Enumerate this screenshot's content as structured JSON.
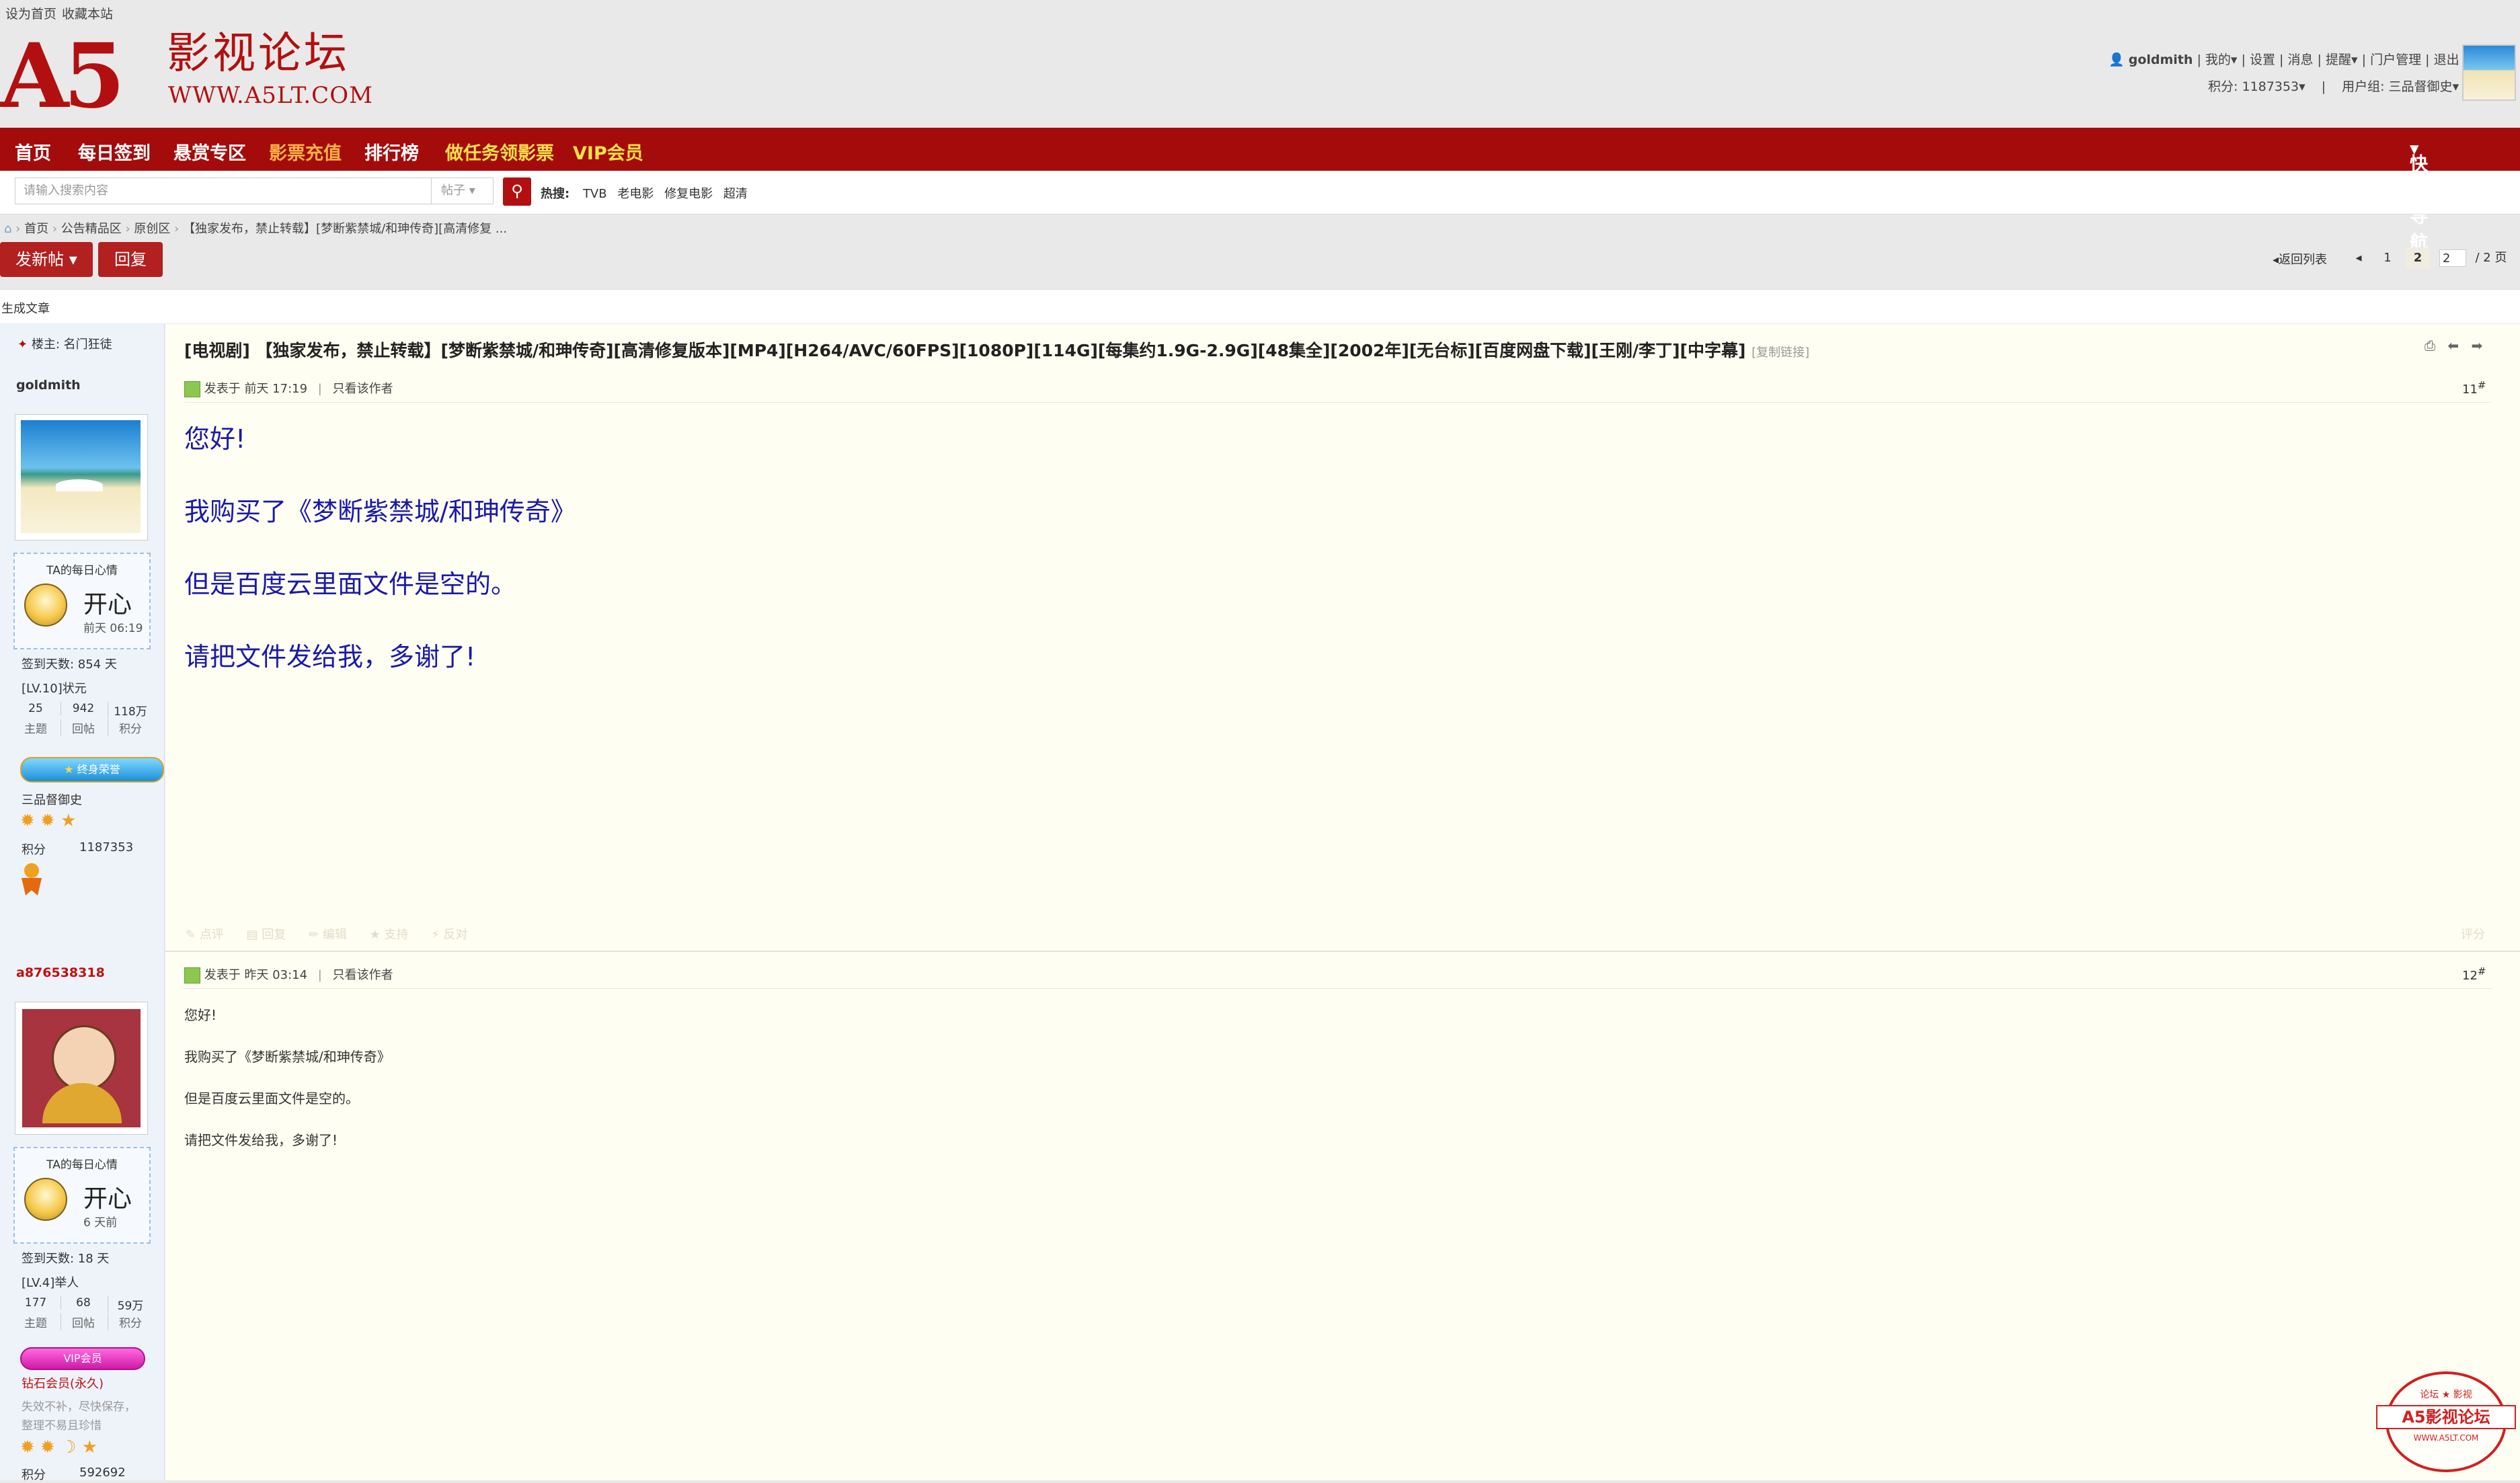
{
  "topbar": {
    "set_home": "设为首页",
    "bookmark": "收藏本站"
  },
  "logo": {
    "mark": "A5",
    "name": "影视论坛",
    "url": "WWW.A5LT.COM"
  },
  "user": {
    "name": "goldmith",
    "my": "我的",
    "settings": "设置",
    "messages": "消息",
    "remind": "提醒",
    "portal_admin": "门户管理",
    "logout": "退出",
    "points_label": "积分: 1187353",
    "group_label": "用户组: 三品督御史"
  },
  "nav": {
    "items": [
      "首页",
      "每日签到",
      "悬赏专区",
      "影票充值",
      "排行榜",
      "做任务领影票",
      "VIP会员"
    ],
    "quick": "快捷导航"
  },
  "search": {
    "placeholder": "请输入搜索内容",
    "type": "帖子",
    "hot_label": "热搜:",
    "hot": [
      "TVB",
      "老电影",
      "修复电影",
      "超清"
    ]
  },
  "breadcrumb": {
    "items": [
      "首页",
      "公告精品区",
      "原创区",
      "【独家发布，禁止转载】[梦断紫禁城/和珅传奇][高清修复 ..."
    ]
  },
  "buttons": {
    "new_post": "发新帖",
    "reply": "回复"
  },
  "pager": {
    "back": "返回列表",
    "page1": "1",
    "page2": "2",
    "input": "2",
    "total": "/ 2 页"
  },
  "sub": {
    "label": "生成文章"
  },
  "thread": {
    "title": "[电视剧] 【独家发布，禁止转载】[梦断紫禁城/和珅传奇][高清修复版本][MP4][H264/AVC/60FPS][1080P][114G][每集约1.9G-2.9G][48集全][2002年][无台标][百度网盘下载][王刚/李丁][中字幕]",
    "copy_link": "[复制链接]",
    "owner": "楼主: 名门狂徒"
  },
  "posts": [
    {
      "author": "goldmith",
      "mood_title": "TA的每日心情",
      "mood": "开心",
      "mood_time": "前天 06:19",
      "sign_days": "签到天数: 854 天",
      "level": "[LV.10]状元",
      "stats": [
        {
          "num": "25",
          "label": "主题"
        },
        {
          "num": "942",
          "label": "回帖"
        },
        {
          "num": "118万",
          "label": "积分"
        }
      ],
      "badge": "终身荣誉",
      "group": "三品督御史",
      "points_label": "积分",
      "points": "1187353",
      "meta": "发表于 前天 17:19",
      "only_author": "只看该作者",
      "num": "11",
      "lines": [
        "您好!",
        "我购买了《梦断紫禁城/和珅传奇》",
        "但是百度云里面文件是空的。",
        "请把文件发给我，多谢了!"
      ],
      "actions": [
        "点评",
        "回复",
        "编辑",
        "支持",
        "反对"
      ],
      "rate": "评分"
    },
    {
      "author": "a876538318",
      "mood_title": "TA的每日心情",
      "mood": "开心",
      "mood_time": "6 天前",
      "sign_days": "签到天数: 18 天",
      "level": "[LV.4]举人",
      "stats": [
        {
          "num": "177",
          "label": "主题"
        },
        {
          "num": "68",
          "label": "回帖"
        },
        {
          "num": "59万",
          "label": "积分"
        }
      ],
      "badge": "VIP会员",
      "group": "钻石会员(永久)",
      "note": [
        "失效不补，尽快保存，",
        "整理不易且珍惜"
      ],
      "points_label": "积分",
      "points": "592692",
      "meta": "发表于 昨天 03:14",
      "only_author": "只看该作者",
      "num": "12",
      "lines": [
        "您好!",
        "我购买了《梦断紫禁城/和珅传奇》",
        "但是百度云里面文件是空的。",
        "请把文件发给我，多谢了!"
      ]
    }
  ],
  "stamp": {
    "top": "论坛 ★ 影视",
    "name": "A5影视论坛",
    "url": "WWW.A5LT.COM"
  }
}
